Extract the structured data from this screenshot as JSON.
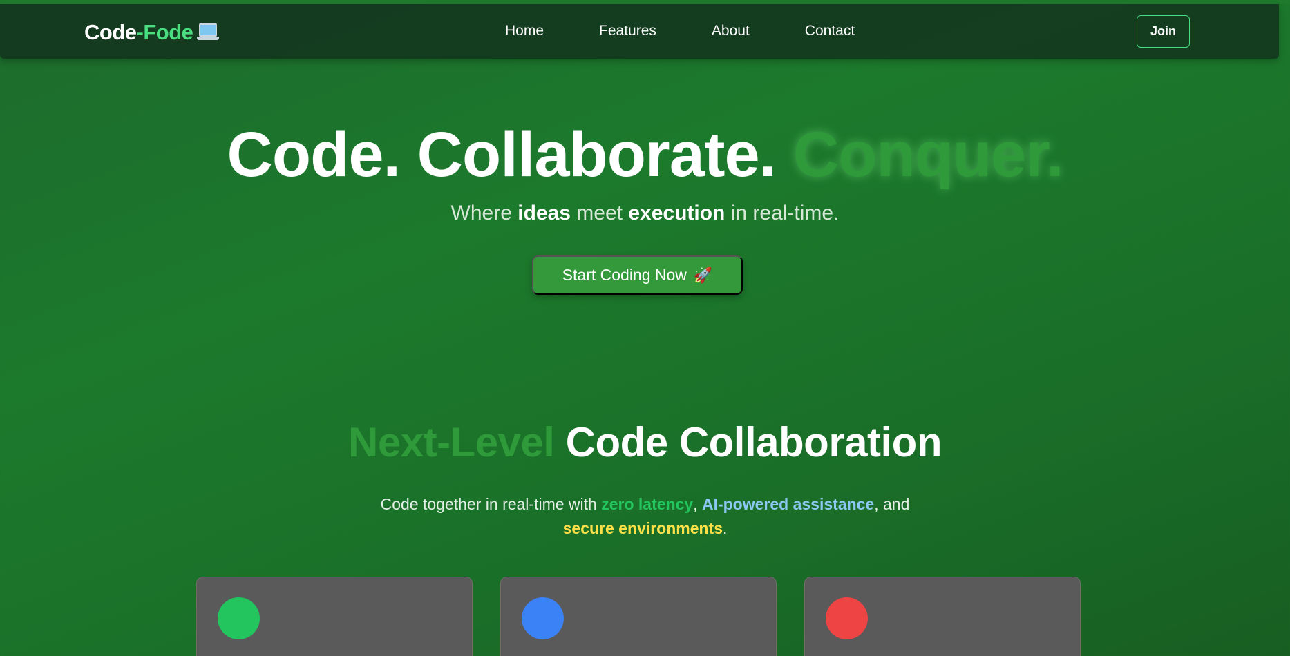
{
  "brand": {
    "name_part1": "Code",
    "name_part2": "-Fode",
    "icon": "laptop-icon"
  },
  "nav": {
    "links": [
      "Home",
      "Features",
      "About",
      "Contact"
    ],
    "join_label": "Join"
  },
  "hero": {
    "title_main": "Code. Collaborate. ",
    "title_glow": "Conquer.",
    "sub_where": "Where ",
    "sub_ideas": "ideas",
    "sub_meet": " meet ",
    "sub_execution": "execution",
    "sub_end": " in real-time.",
    "cta_label": "Start Coding Now",
    "cta_icon": "rocket-icon"
  },
  "section": {
    "title_muted": "Next-Level",
    "title_main": " Code Collaboration",
    "desc_start": "Code together in real-time with ",
    "desc_latency": "zero latency",
    "desc_comma": ", ",
    "desc_ai": "AI-powered assistance",
    "desc_and": ", and",
    "desc_secure": "secure environments",
    "desc_period": "."
  },
  "cards": [
    {
      "color": "#22c55e"
    },
    {
      "color": "#3b82f6"
    },
    {
      "color": "#ef4444"
    }
  ],
  "colors": {
    "accent": "#4ade80",
    "cta": "#34993a"
  }
}
